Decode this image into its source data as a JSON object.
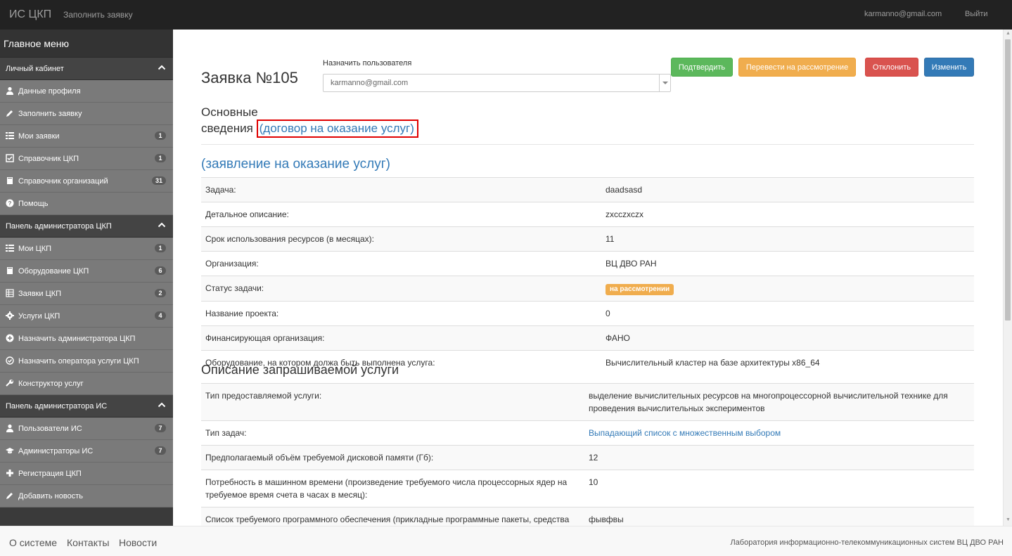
{
  "navbar": {
    "brand": "ИС ЦКП",
    "fill_request": "Заполнить заявку",
    "user_email": "karmanno@gmail.com",
    "logout": "Выйти"
  },
  "sidebar": {
    "title": "Главное меню",
    "sections": [
      {
        "title": "Личный кабинет",
        "items": [
          {
            "label": "Данные профиля",
            "icon": "user-icon",
            "badge": ""
          },
          {
            "label": "Заполнить заявку",
            "icon": "pencil-icon",
            "badge": ""
          },
          {
            "label": "Мои заявки",
            "icon": "list-icon",
            "badge": "1"
          },
          {
            "label": "Справочник ЦКП",
            "icon": "check-square-icon",
            "badge": "1"
          },
          {
            "label": "Справочник организаций",
            "icon": "book-icon",
            "badge": "31"
          },
          {
            "label": "Помощь",
            "icon": "question-circle-icon",
            "badge": ""
          }
        ]
      },
      {
        "title": "Панель администратора ЦКП",
        "items": [
          {
            "label": "Мои ЦКП",
            "icon": "list-icon",
            "badge": "1"
          },
          {
            "label": "Оборудование ЦКП",
            "icon": "book-icon",
            "badge": "6"
          },
          {
            "label": "Заявки ЦКП",
            "icon": "table-icon",
            "badge": "2"
          },
          {
            "label": "Услуги ЦКП",
            "icon": "gear-icon",
            "badge": "4"
          },
          {
            "label": "Назначить администратора ЦКП",
            "icon": "plus-circle-icon",
            "badge": ""
          },
          {
            "label": "Назначить оператора услуги ЦКП",
            "icon": "check-circle-icon",
            "badge": ""
          },
          {
            "label": "Конструктор услуг",
            "icon": "wrench-icon",
            "badge": ""
          }
        ]
      },
      {
        "title": "Панель администратора ИС",
        "items": [
          {
            "label": "Пользователи ИС",
            "icon": "user-icon",
            "badge": "7"
          },
          {
            "label": "Администраторы ИС",
            "icon": "graduation-cap-icon",
            "badge": "7"
          },
          {
            "label": "Регистрация ЦКП",
            "icon": "plus-icon",
            "badge": ""
          },
          {
            "label": "Добавить новость",
            "icon": "pencil-icon",
            "badge": ""
          }
        ]
      }
    ]
  },
  "main": {
    "title": "Заявка №105",
    "assign_label": "Назначить пользователя",
    "assign_value": "karmanno@gmail.com",
    "buttons": {
      "confirm": "Подтвердить",
      "review": "Перевести на рассмотрение",
      "reject": "Отклонить",
      "edit": "Изменить"
    },
    "basic_title_line1": "Основные",
    "basic_title_line2": "сведения",
    "contract_link": "(договор на оказание услуг)",
    "application_link": "(заявление на оказание услуг)",
    "info_rows": [
      {
        "label": "Задача:",
        "value": "daadsasd"
      },
      {
        "label": "Детальное описание:",
        "value": "zxcczxczx"
      },
      {
        "label": "Срок использования ресурсов (в месяцах):",
        "value": "11"
      },
      {
        "label": "Организация:",
        "value": "ВЦ ДВО РАН"
      },
      {
        "label": "Статус задачи:",
        "value": "на рассмотрении"
      },
      {
        "label": "Название проекта:",
        "value": "0"
      },
      {
        "label": "Финансирующая организация:",
        "value": "ФАНО"
      },
      {
        "label": "Оборудование, на котором должа быть выполнена услуга:",
        "value": "Вычислительный кластер на базе архитектуры x86_64"
      }
    ],
    "service_title": "Описание запрашиваемой услуги",
    "service_rows": [
      {
        "label": "Тип предоставляемой услуги:",
        "value": "выделение вычислительных ресурсов на многопроцессорной вычислительной технике для проведения вычислительных экспериментов"
      },
      {
        "label": "Тип задач:",
        "value": "Выпадающий список с множественным выбором"
      },
      {
        "label": "Предполагаемый объём требуемой дисковой памяти (Гб):",
        "value": "12"
      },
      {
        "label": "Потребность в машинном времени (произведение требуемого числа процессорных ядер на требуемое время счета в часах в месяц):",
        "value": "10"
      },
      {
        "label": "Список требуемого программного обеспечения (прикладные программные пакеты, средства разработки):",
        "value": "фывфвы"
      }
    ]
  },
  "footer": {
    "about": "О системе",
    "contacts": "Контакты",
    "news": "Новости",
    "copyright": "Лаборатория информационно-телекоммуникационных систем ВЦ ДВО РАН"
  },
  "colors": {
    "navbar_bg": "#222222",
    "sidebar_item_bg": "#7a7a7a",
    "link": "#337ab7",
    "status_warning": "#f0ad4e",
    "highlight_box": "#e00000"
  }
}
